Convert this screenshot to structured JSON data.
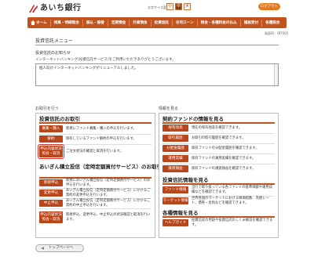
{
  "header": {
    "bank_name": "あいち銀行",
    "fontsize_label": "文字サイズ変更",
    "fontsize_small": "小",
    "fontsize_medium": "中",
    "fontsize_large": "大",
    "logout_label": "ログアウト"
  },
  "nav": {
    "items": [
      "ホーム",
      "残高・明細照会",
      "振込・振替",
      "定期預金",
      "外貨預金",
      "投資信託",
      "住宅ローン",
      "税金・各種料金の払込",
      "諸届受付",
      "各種照会"
    ]
  },
  "page": {
    "screen_id": "画面ID：IBT005",
    "title": "投資信託メニュー"
  },
  "notice": {
    "heading": "投資信託のお知らせ",
    "subtext": "インターネットバンキング(投資信託サービス)をご利用いただきありがとうございます。",
    "message": "個人向けインターネットバンキングがリニューアルしました。"
  },
  "left": {
    "heading": "お取引を行う",
    "section1": {
      "title": "投資信託のお取引",
      "rows": [
        {
          "button": "募集・購入",
          "desc": "新規にファンド募集・購入の申込を行います。"
        },
        {
          "button": "解約",
          "desc": "保有しているファンド解約の申込を行います。"
        },
        {
          "button": "申込内容状況照会・取消",
          "desc": "ご注文状況の確認と取消を行います。"
        }
      ]
    },
    "section2": {
      "title": "あいぎん積立投信（定時定額買付サービス）のお取引",
      "rows": [
        {
          "button": "新規申込",
          "desc": "新規にあいぎん積立投信（定時定額買付サービス）のお申込を行います。"
        },
        {
          "button": "変更申込",
          "desc": "あいぎん積立投信（定時定額買付サービス）にかかるご契約の変更申込を行います。"
        },
        {
          "button": "中止申込",
          "desc": "あいぎん積立投信（定時定額買付サービス）にかかるご契約の中止申込を行います。"
        },
        {
          "button": "申込内容状況照会・取消",
          "desc": "新規申込、変更申込、中止申込の状況確認と取消を行います。"
        }
      ]
    }
  },
  "right": {
    "heading": "情報を見る",
    "section1": {
      "title": "契約ファンドの情報を見る",
      "rows": [
        {
          "button": "保有残高",
          "desc": "現在の保有残高を確認できます。"
        },
        {
          "button": "取引履歴",
          "desc": "お取引の取引履歴を確認できます。"
        },
        {
          "button": "分配金履歴",
          "desc": "保有ファンドの分配金履歴を確認できます。"
        },
        {
          "button": "運用実績",
          "desc": "保有ファンドの運用実績を確認できます。"
        },
        {
          "button": "譲渡損益",
          "desc": "保有ファンドの譲渡損益を確認できます。"
        }
      ]
    },
    "section2": {
      "title": "投資信託情報を見る",
      "rows": [
        {
          "button": "ファンド情報",
          "desc": "当行で取り扱っている各ファンドの基準価額や運用成績などを確認できます。"
        },
        {
          "button": "マーケット情報",
          "desc": "世界各国のマーケットにおける株価指数、為替レート、債券・金利などを確認できます。"
        }
      ]
    },
    "section3": {
      "title": "各種情報を見る",
      "rows": [
        {
          "button": "ヘルプガイド",
          "desc": "投資信託の用語や投資信託のしくみ解説を確認できます。"
        }
      ]
    }
  },
  "footer": {
    "top_label": "トップページへ"
  },
  "colors": {
    "brand": "#c1541d",
    "button": "#b9461a",
    "logout": "#e37a1f"
  }
}
